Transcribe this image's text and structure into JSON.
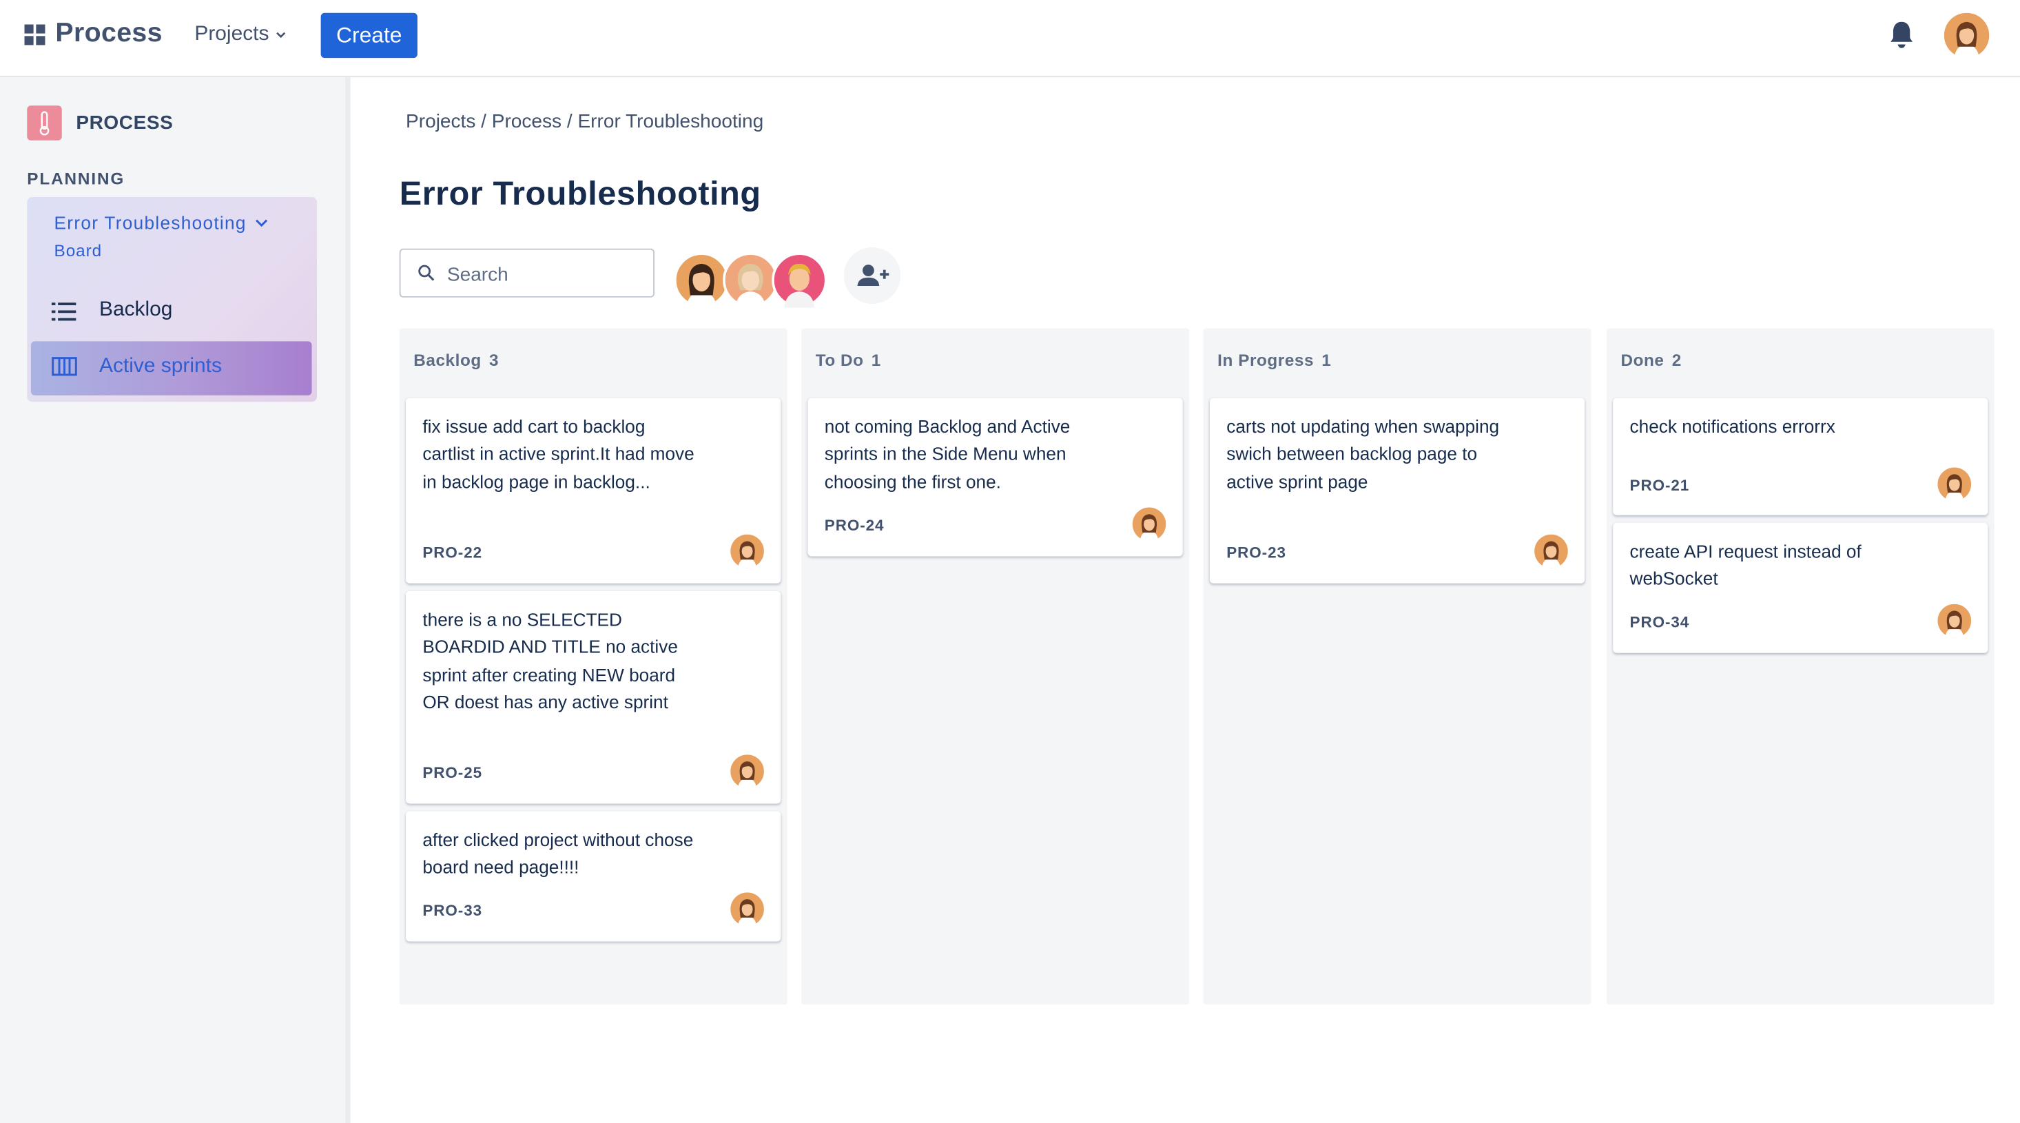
{
  "app": {
    "brand": "Process",
    "projects_menu": "Projects",
    "create_label": "Create"
  },
  "sidebar": {
    "project_name": "PROCESS",
    "section": "PLANNING",
    "board_name": "Error Troubleshooting",
    "board_sub": "Board",
    "items": [
      {
        "label": "Backlog",
        "icon": "list-icon"
      },
      {
        "label": "Active sprints",
        "icon": "board-columns-icon"
      }
    ]
  },
  "main": {
    "breadcrumb": "Projects / Process / Error Troubleshooting",
    "title": "Error Troubleshooting",
    "search_placeholder": "Search"
  },
  "columns": [
    {
      "title": "Backlog",
      "count": "3",
      "cards": [
        {
          "text": "fix issue add cart to backlog cartlist in active sprint.It had move in backlog page in backlog...",
          "key": "PRO-22"
        },
        {
          "text": "there is a no SELECTED BOARDID AND TITLE no active sprint after creating NEW board OR doest has any active sprint",
          "key": "PRO-25"
        },
        {
          "text": "after clicked project without chose board need page!!!!",
          "key": "PRO-33"
        }
      ]
    },
    {
      "title": "To Do",
      "count": "1",
      "cards": [
        {
          "text": "not coming Backlog and Active sprints in the Side Menu when choosing the first one.",
          "key": "PRO-24"
        }
      ]
    },
    {
      "title": "In Progress",
      "count": "1",
      "cards": [
        {
          "text": "carts not updating when swapping swich between backlog page to active sprint page",
          "key": "PRO-23"
        }
      ]
    },
    {
      "title": "Done",
      "count": "2",
      "cards": [
        {
          "text": "check notifications errorrx",
          "key": "PRO-21"
        },
        {
          "text": "create API request instead of webSocket",
          "key": "PRO-34"
        }
      ]
    }
  ],
  "colors": {
    "accent": "#1f64d8",
    "sidebar_bg": "#f4f5f7",
    "column_bg": "#f4f5f7",
    "project_icon": "#ec8c9b"
  }
}
